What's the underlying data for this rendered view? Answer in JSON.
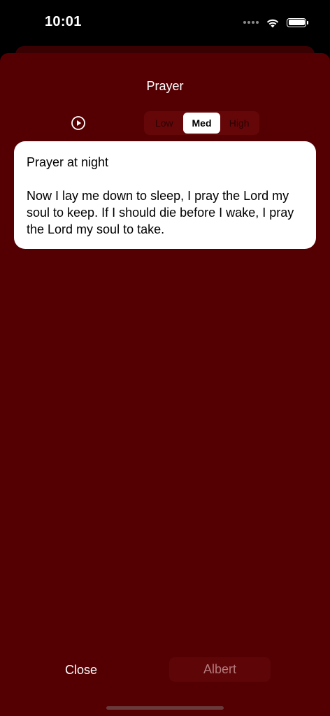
{
  "status_bar": {
    "time": "10:01",
    "wifi_icon": "wifi-icon",
    "battery_icon": "battery-icon"
  },
  "sheet": {
    "title": "Prayer",
    "play_icon": "play-circle-icon",
    "intensity_segments": [
      {
        "label": "Low",
        "selected": false
      },
      {
        "label": "Med",
        "selected": true
      },
      {
        "label": "High",
        "selected": false
      }
    ],
    "card": {
      "title": "Prayer at night",
      "body": "Now I lay me down to sleep, I pray the Lord my soul to keep. If I should die before I wake, I pray the Lord my soul to take."
    },
    "footer": {
      "close_label": "Close",
      "user_label": "Albert"
    }
  },
  "colors": {
    "sheet_bg": "#540002",
    "card_bg": "#ffffff",
    "segment_bg": "#650709"
  }
}
